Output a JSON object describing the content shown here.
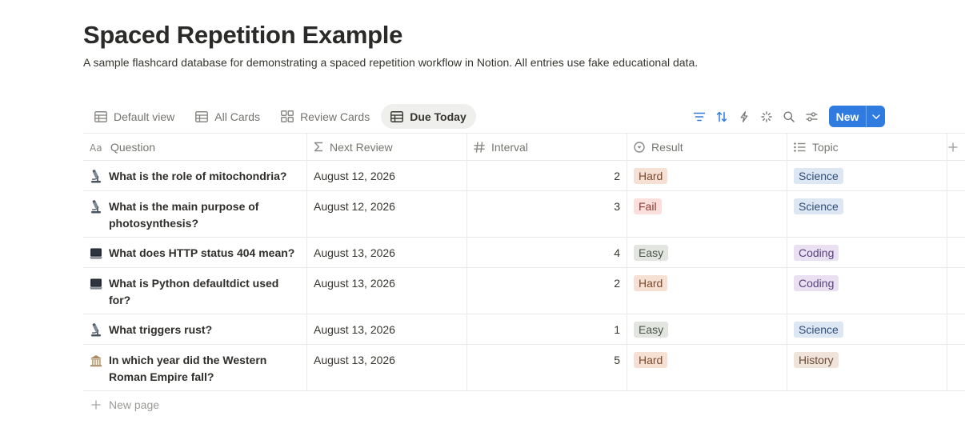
{
  "page": {
    "title": "Spaced Repetition Example",
    "description": "A sample flashcard database for demonstrating a spaced repetition workflow in Notion. All entries use fake educational data."
  },
  "tabs": [
    {
      "label": "Default view",
      "icon": "table-icon",
      "active": false
    },
    {
      "label": "All Cards",
      "icon": "table-icon",
      "active": false
    },
    {
      "label": "Review Cards",
      "icon": "gallery-icon",
      "active": false
    },
    {
      "label": "Due Today",
      "icon": "table-icon",
      "active": true
    }
  ],
  "toolbar": {
    "icons": [
      "filter-icon",
      "sort-icon",
      "automation-icon",
      "loading-icon",
      "search-icon",
      "settings-icon"
    ],
    "new_label": "New",
    "accent": "#2f7be0"
  },
  "columns": {
    "question": "Question",
    "next_review": "Next Review",
    "interval": "Interval",
    "result": "Result",
    "topic": "Topic"
  },
  "rows": [
    {
      "emoji": "microscope",
      "question": "What is the role of mitochondria?",
      "next_review": "August 12, 2026",
      "interval": "2",
      "result": "Hard",
      "topic": "Science"
    },
    {
      "emoji": "microscope",
      "question": "What is the main purpose of photosynthesis?",
      "next_review": "August 12, 2026",
      "interval": "3",
      "result": "Fail",
      "topic": "Science"
    },
    {
      "emoji": "laptop",
      "question": "What does HTTP status 404 mean?",
      "next_review": "August 13, 2026",
      "interval": "4",
      "result": "Easy",
      "topic": "Coding"
    },
    {
      "emoji": "laptop",
      "question": "What is Python defaultdict used for?",
      "next_review": "August 13, 2026",
      "interval": "2",
      "result": "Hard",
      "topic": "Coding"
    },
    {
      "emoji": "microscope",
      "question": "What triggers rust?",
      "next_review": "August 13, 2026",
      "interval": "1",
      "result": "Easy",
      "topic": "Science"
    },
    {
      "emoji": "classical-building",
      "question": "In which year did the Western Roman Empire fall?",
      "next_review": "August 13, 2026",
      "interval": "5",
      "result": "Hard",
      "topic": "History"
    }
  ],
  "tag_colors": {
    "Hard": {
      "bg": "#f5e0d3",
      "fg": "#7a4a2e"
    },
    "Fail": {
      "bg": "#fbdfdc",
      "fg": "#8a3a33"
    },
    "Easy": {
      "bg": "#e3e6e0",
      "fg": "#4a5448"
    },
    "Science": {
      "bg": "#dde6f3",
      "fg": "#2f4e78"
    },
    "Coding": {
      "bg": "#e9e1f2",
      "fg": "#5a3f7e"
    },
    "History": {
      "bg": "#efe3da",
      "fg": "#6a4a36"
    }
  },
  "new_page_label": "New page"
}
